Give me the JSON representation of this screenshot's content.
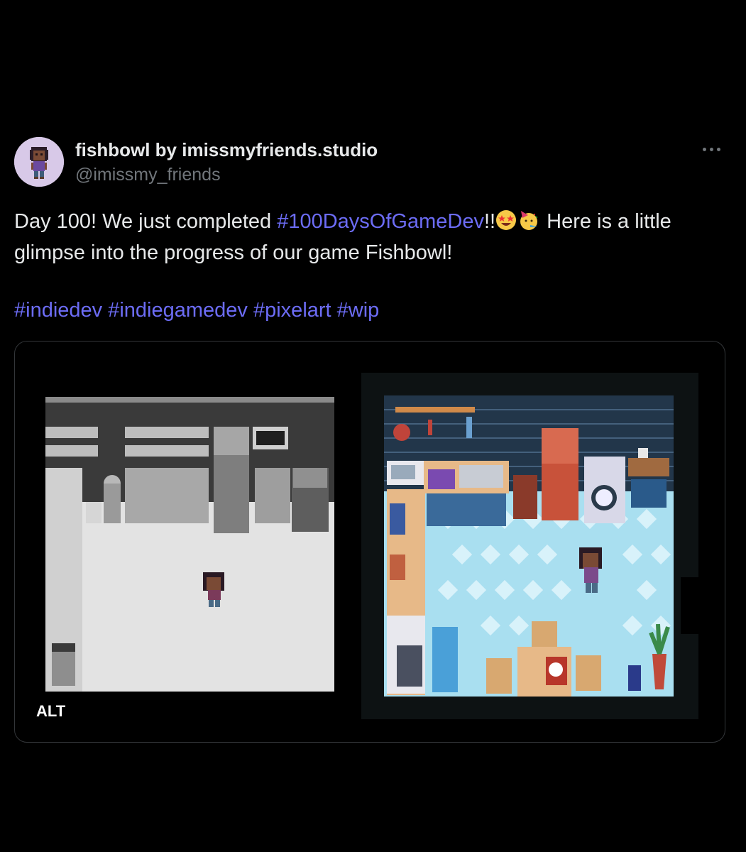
{
  "author": {
    "display_name": "fishbowl by imissmyfriends.studio",
    "handle": "@imissmy_friends"
  },
  "tweet": {
    "text_part1": "Day 100! We just completed ",
    "hashtag_main": "#100DaysOfGameDev",
    "text_part2": "!!",
    "text_part3": " Here is a little glimpse into the progress of our game Fishbowl!",
    "hashtags": [
      "#indiedev",
      "#indiegamedev",
      "#pixelart",
      "#wip"
    ]
  },
  "media": {
    "alt_badge": "ALT"
  },
  "icons": {
    "more": "more-options-icon",
    "emoji_1": "star-struck-emoji",
    "emoji_2": "partying-face-emoji"
  },
  "colors": {
    "background": "#000000",
    "text": "#e7e9ea",
    "secondary_text": "#71767b",
    "hashtag": "#6c6cf5",
    "border": "#333639"
  }
}
